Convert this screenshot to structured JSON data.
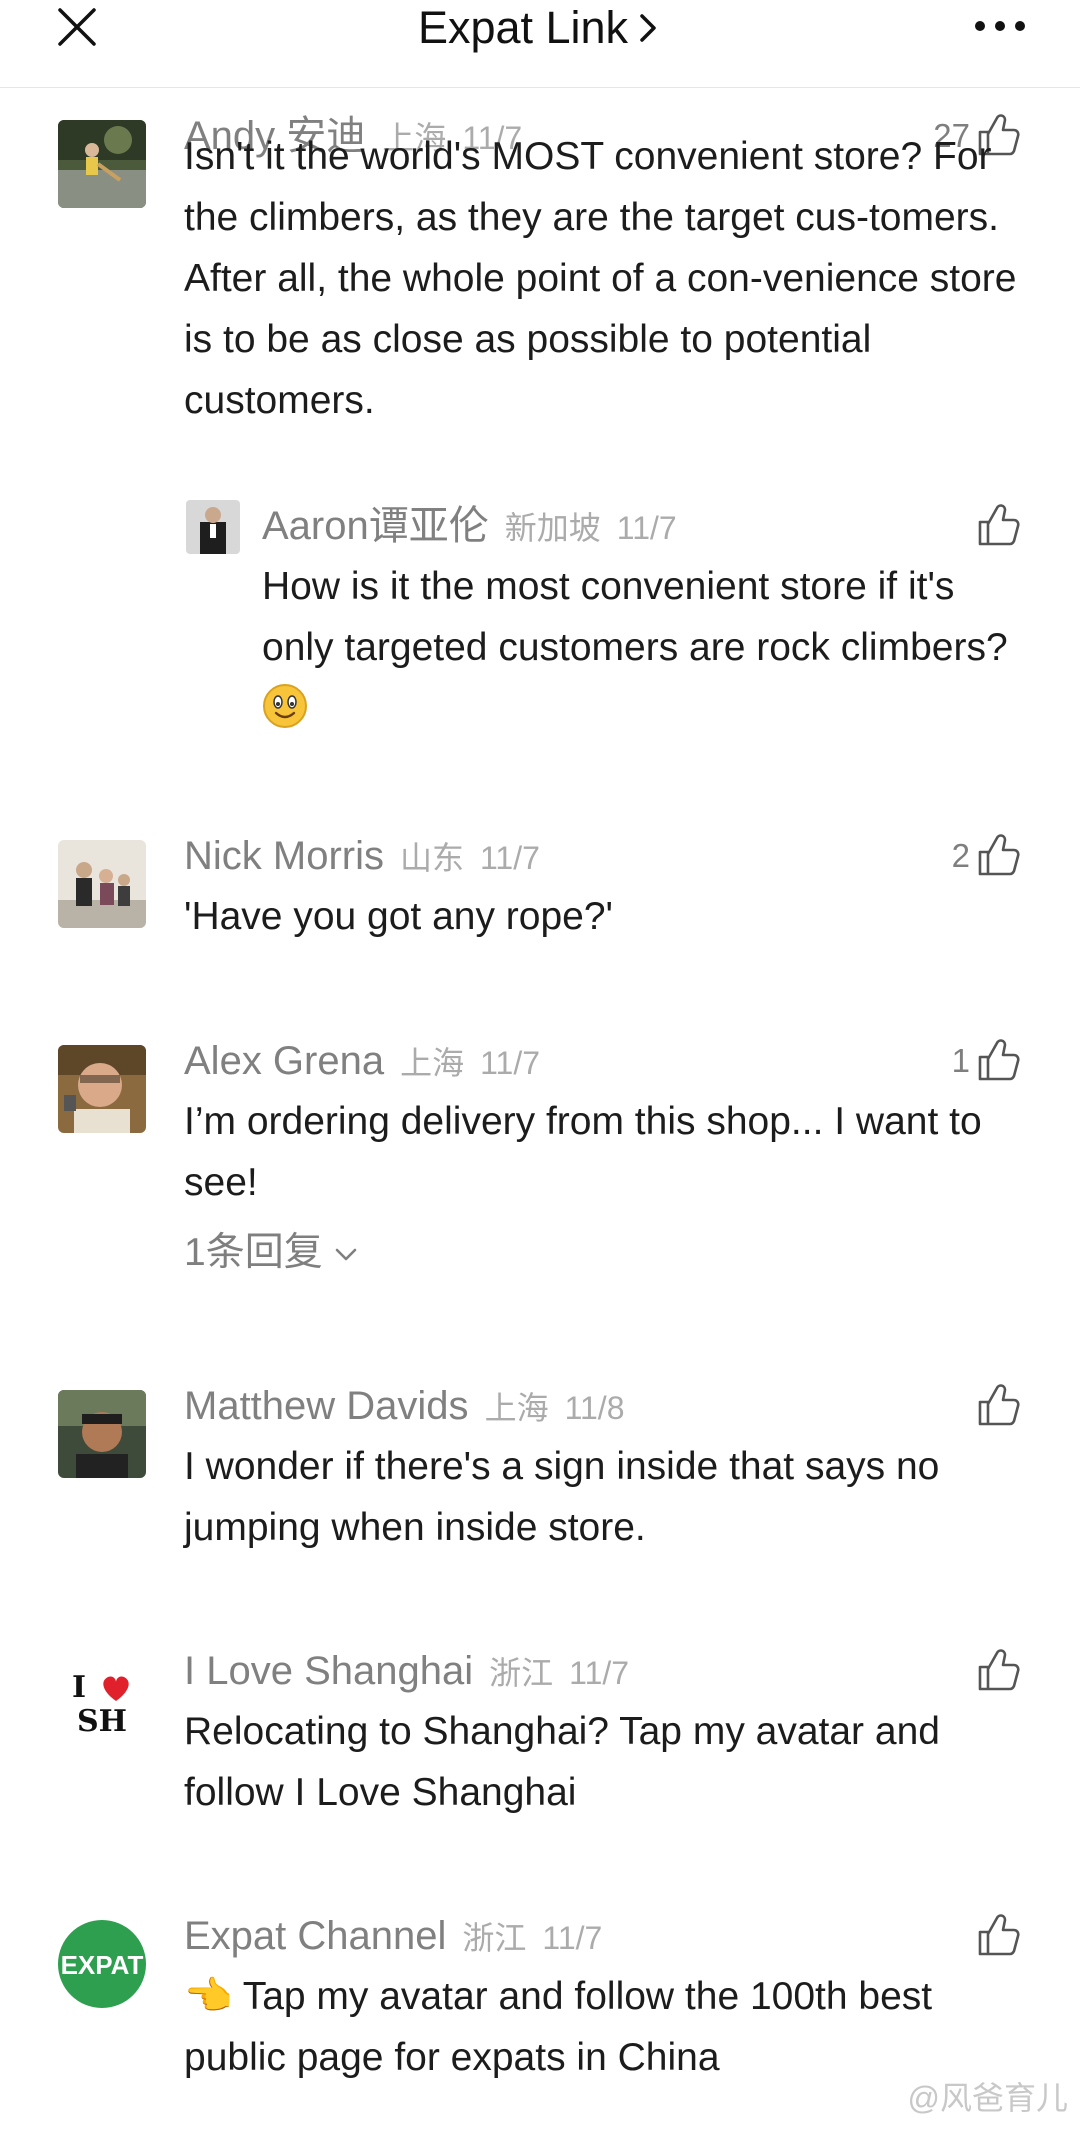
{
  "header": {
    "title": "Expat Link",
    "close_icon": "close-icon",
    "more_icon": "more-icon"
  },
  "comments": [
    {
      "author": "Andy 安迪",
      "region": "上海",
      "date": "11/7",
      "likes": "27",
      "text": "Isn't it the world's MOST convenient store? For the climbers, as they are the target cus-tomers. After all, the whole point of a con-venience store is to be as close as possible to potential customers.",
      "reply": {
        "author": "Aaron谭亚伦",
        "region": "新加坡",
        "date": "11/7",
        "likes": "",
        "text": "How is it the most convenient store if it's only targeted customers are rock climbers?",
        "emoji": "smiley-emoji"
      }
    },
    {
      "author": "Nick Morris",
      "region": "山东",
      "date": "11/7",
      "likes": "2",
      "text": "'Have you got any rope?'"
    },
    {
      "author": "Alex Grena",
      "region": "上海",
      "date": "11/7",
      "likes": "1",
      "text": "I’m ordering delivery from this shop... I want to see!",
      "replies_toggle": "1条回复"
    },
    {
      "author": "Matthew Davids",
      "region": "上海",
      "date": "11/8",
      "likes": "",
      "text": "I wonder if there's a sign inside that says no jumping when inside store."
    },
    {
      "author": "I Love Shanghai",
      "region": "浙江",
      "date": "11/7",
      "likes": "",
      "text": "Relocating to Shanghai? Tap my avatar and follow I Love Shanghai",
      "avatar_text": {
        "line1_left": "I",
        "line2": "SH"
      }
    },
    {
      "author": "Expat Channel",
      "region": "浙江",
      "date": "11/7",
      "likes": "",
      "text": "Tap my avatar and follow the 100th best public page for expats in China",
      "lead_emoji": "👈",
      "avatar_text": "EXPAT"
    }
  ],
  "watermark": "@风爸育儿",
  "colors": {
    "author": "#808080",
    "meta": "#ababab",
    "text": "#1c1c1c",
    "expat_green": "#2e9e4f",
    "heart": "#e0202b"
  }
}
